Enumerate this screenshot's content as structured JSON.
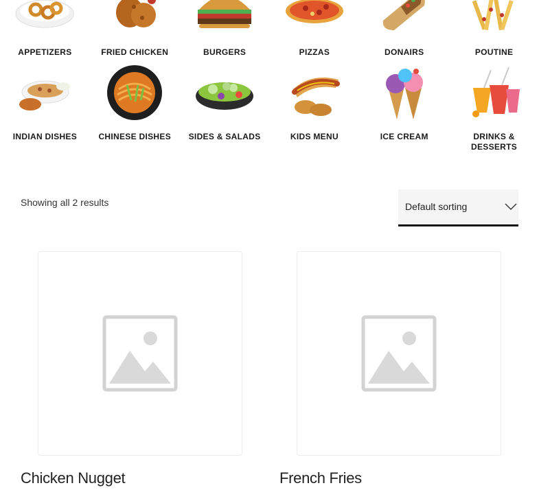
{
  "categories": [
    {
      "label": "APPETIZERS",
      "icon": "appetizers-plate-icon"
    },
    {
      "label": "FRIED CHICKEN",
      "icon": "fried-chicken-icon"
    },
    {
      "label": "BURGERS",
      "icon": "burger-icon"
    },
    {
      "label": "PIZZAS",
      "icon": "pizza-icon"
    },
    {
      "label": "DONAIRS",
      "icon": "donair-wrap-icon"
    },
    {
      "label": "POUTINE",
      "icon": "poutine-icon"
    },
    {
      "label": "INDIAN DISHES",
      "icon": "indian-dish-icon"
    },
    {
      "label": "CHINESE DISHES",
      "icon": "noodles-bowl-icon"
    },
    {
      "label": "SIDES & SALADS",
      "icon": "salad-bowl-icon"
    },
    {
      "label": "KIDS MENU",
      "icon": "hotdog-icon"
    },
    {
      "label": "ICE CREAM",
      "icon": "ice-cream-cone-icon"
    },
    {
      "label": "DRINKS & DESSERTS",
      "icon": "drinks-icon"
    }
  ],
  "shop": {
    "result_count": "Showing all 2 results",
    "sorting_selected": "Default sorting"
  },
  "products": [
    {
      "title": "Chicken Nugget",
      "image": "placeholder-image-icon"
    },
    {
      "title": "French Fries",
      "image": "placeholder-image-icon"
    }
  ],
  "colors": {
    "text": "#1a1a1a",
    "sort_bg": "#f5f5f5",
    "sort_border": "#111111",
    "placeholder_gray": "#d9d9d9"
  }
}
